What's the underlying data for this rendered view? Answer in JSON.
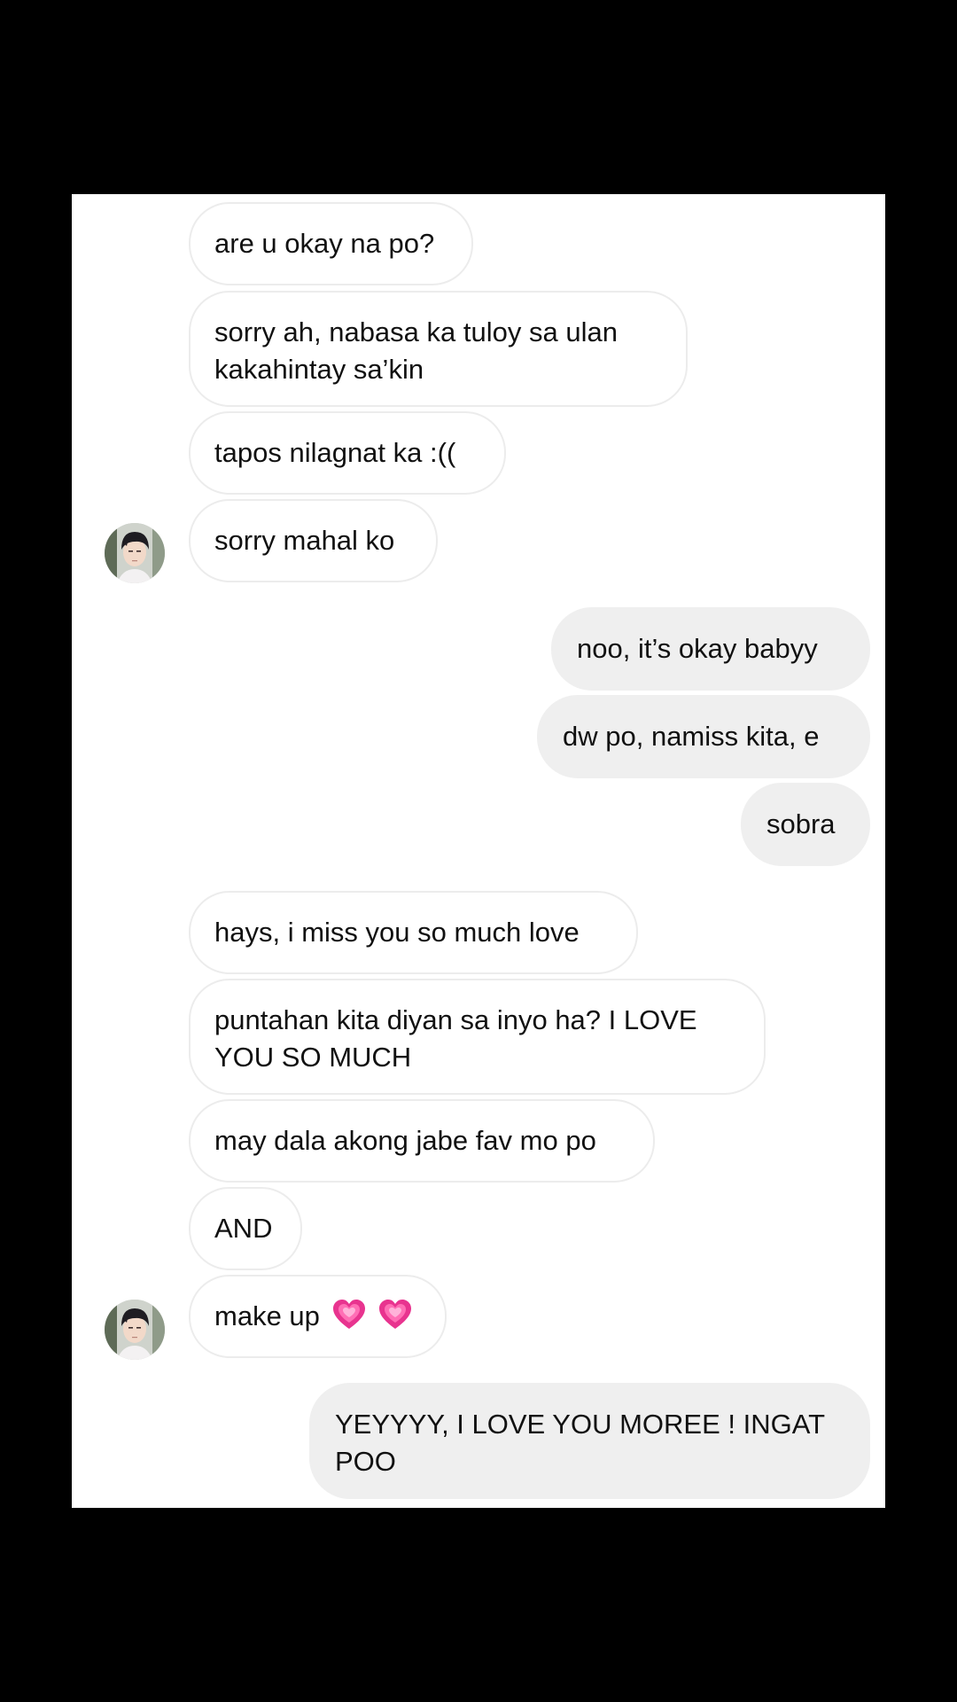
{
  "chat": {
    "messages": [
      {
        "side": "in",
        "text": "are u okay na po?"
      },
      {
        "side": "in",
        "text": "sorry ah, nabasa ka tuloy sa ulan",
        "text2": "kakahintay sa’kin"
      },
      {
        "side": "in",
        "text": "tapos nilagnat ka :(("
      },
      {
        "side": "in",
        "text": "sorry mahal ko"
      },
      {
        "side": "out",
        "text": "noo, it’s okay babyy"
      },
      {
        "side": "out",
        "text": "dw po, namiss kita, e"
      },
      {
        "side": "out",
        "text": "sobra"
      },
      {
        "side": "in",
        "text": "hays, i miss you so much love"
      },
      {
        "side": "in",
        "text": "puntahan kita diyan sa inyo ha? I LOVE",
        "text2": "YOU SO MUCH"
      },
      {
        "side": "in",
        "text": "may dala akong jabe fav mo po"
      },
      {
        "side": "in",
        "text": "AND"
      },
      {
        "side": "in",
        "text": "make up",
        "emoji": [
          "growing-heart-icon",
          "growing-heart-icon"
        ]
      },
      {
        "side": "out",
        "text": "YEYYYY, I LOVE YOU MOREE ! INGAT",
        "text2": "POO"
      }
    ]
  },
  "colors": {
    "background": "#000000",
    "panel": "#ffffff",
    "incoming_bubble": "#ffffff",
    "incoming_border": "#ececec",
    "outgoing_bubble": "#efefef",
    "heart": "#e8348f"
  }
}
